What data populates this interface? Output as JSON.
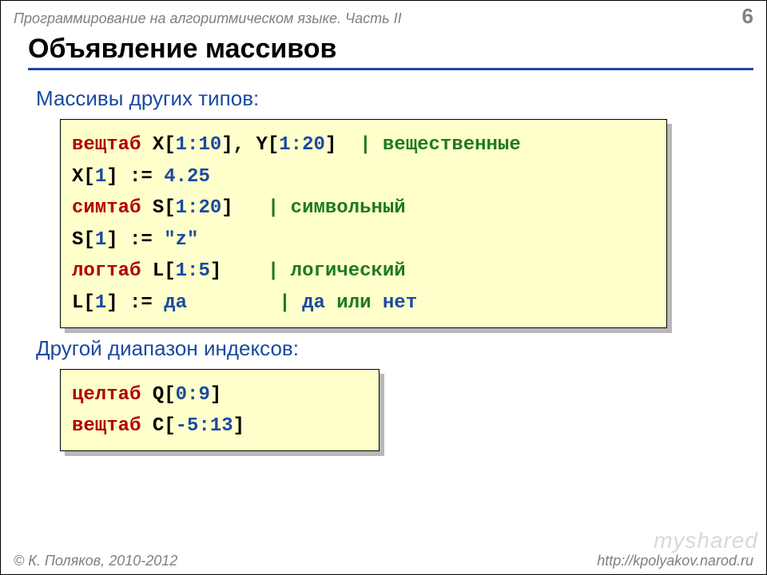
{
  "header": {
    "breadcrumb": "Программирование на алгоритмическом языке. Часть II",
    "page_number": "6"
  },
  "title": "Объявление массивов",
  "sections": {
    "s1_heading": "Массивы других типов:",
    "s2_heading": "Другой диапазон индексов:"
  },
  "code1": {
    "l1_kw": "вещтаб",
    "l1_body": " X[",
    "l1_r1": "1:10",
    "l1_mid": "], Y[",
    "l1_r2": "1:20",
    "l1_end": "]  ",
    "l1_com": "| вещественные",
    "l2_a": "X[",
    "l2_i": "1",
    "l2_b": "] := ",
    "l2_v": "4.25",
    "l3_kw": "симтаб",
    "l3_a": " S[",
    "l3_r": "1:20",
    "l3_b": "]   ",
    "l3_com": "| символьный",
    "l4_a": "S[",
    "l4_i": "1",
    "l4_b": "] := ",
    "l4_v": "\"z\"",
    "l5_kw": "логтаб",
    "l5_a": " L[",
    "l5_r": "1:5",
    "l5_b": "]    ",
    "l5_com": "| логический",
    "l6_a": "L[",
    "l6_i": "1",
    "l6_b": "] := ",
    "l6_v": "да",
    "l6_pad": "        ",
    "l6_c1": "| ",
    "l6_c2": "да",
    "l6_c3": " или ",
    "l6_c4": "нет"
  },
  "code2": {
    "l1_kw": "целтаб",
    "l1_a": " Q[",
    "l1_r": "0:9",
    "l1_b": "]",
    "l2_kw": "вещтаб",
    "l2_a": " C[",
    "l2_r": "-5:13",
    "l2_b": "]"
  },
  "footer": {
    "copyright_sym": "©",
    "copyright": " К. Поляков, 2010-2012",
    "url": "http://kpolyakov.narod.ru"
  },
  "watermark": "myshared"
}
